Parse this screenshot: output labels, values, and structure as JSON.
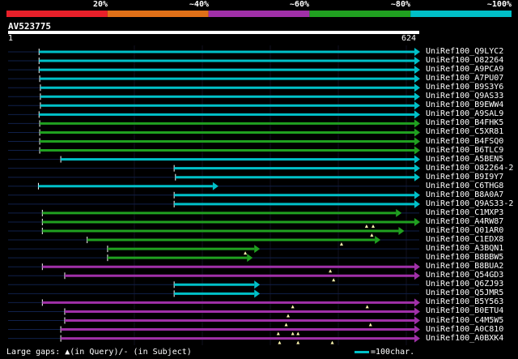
{
  "colors": {
    "red": "#e8202a",
    "orange": "#e07018",
    "purple": "#a030a8",
    "green": "#20a020",
    "cyan": "#00c0c8",
    "gap_marker": "#fff8b0",
    "faint_line": "#10204a",
    "grid": "#101020"
  },
  "legend_bar": {
    "segments": [
      {
        "label": "20%",
        "color": "#e8202a"
      },
      {
        "label": "~40%",
        "color": "#e07018"
      },
      {
        "label": "~60%",
        "color": "#a030a8"
      },
      {
        "label": "~80%",
        "color": "#20a020"
      },
      {
        "label": "~100%",
        "color": "#00c0c8"
      }
    ]
  },
  "query": {
    "name": "AV523775",
    "start": "1",
    "end": "624",
    "length": 624
  },
  "hits": [
    {
      "label": "UniRef100_Q9LYC2",
      "color": "cyan",
      "start": 47,
      "end": 624,
      "gaps": []
    },
    {
      "label": "UniRef100_O82264",
      "color": "cyan",
      "start": 47,
      "end": 624,
      "gaps": []
    },
    {
      "label": "UniRef100_A9PCA9",
      "color": "cyan",
      "start": 47,
      "end": 624,
      "gaps": []
    },
    {
      "label": "UniRef100_A7PU07",
      "color": "cyan",
      "start": 48,
      "end": 624,
      "gaps": []
    },
    {
      "label": "UniRef100_B9S3Y6",
      "color": "cyan",
      "start": 49,
      "end": 624,
      "gaps": []
    },
    {
      "label": "UniRef100_Q9AS33",
      "color": "cyan",
      "start": 49,
      "end": 624,
      "gaps": []
    },
    {
      "label": "UniRef100_B9EWW4",
      "color": "cyan",
      "start": 49,
      "end": 624,
      "gaps": []
    },
    {
      "label": "UniRef100_A9SAL9",
      "color": "cyan",
      "start": 47,
      "end": 624,
      "gaps": []
    },
    {
      "label": "UniRef100_B4FHK5",
      "color": "green",
      "start": 48,
      "end": 624,
      "gaps": []
    },
    {
      "label": "UniRef100_C5XR81",
      "color": "green",
      "start": 48,
      "end": 624,
      "gaps": []
    },
    {
      "label": "UniRef100_B4FSQ0",
      "color": "green",
      "start": 48,
      "end": 624,
      "gaps": []
    },
    {
      "label": "UniRef100_B6TLC9",
      "color": "green",
      "start": 48,
      "end": 624,
      "gaps": []
    },
    {
      "label": "UniRef100_A5BEN5",
      "color": "cyan",
      "start": 80,
      "end": 624,
      "gaps": []
    },
    {
      "label": "UniRef100_O82264-2",
      "color": "cyan",
      "start": 252,
      "end": 624,
      "gaps": []
    },
    {
      "label": "UniRef100_B9I9Y7",
      "color": "cyan",
      "start": 254,
      "end": 624,
      "gaps": []
    },
    {
      "label": "UniRef100_C6THG8",
      "color": "cyan",
      "start": 46,
      "end": 318,
      "gaps": []
    },
    {
      "label": "UniRef100_B8A0A7",
      "color": "cyan",
      "start": 252,
      "end": 624,
      "gaps": []
    },
    {
      "label": "UniRef100_Q9AS33-2",
      "color": "cyan",
      "start": 252,
      "end": 624,
      "gaps": []
    },
    {
      "label": "UniRef100_C1MXP3",
      "color": "green",
      "start": 52,
      "end": 596,
      "gaps": []
    },
    {
      "label": "UniRef100_A4RW87",
      "color": "green",
      "start": 52,
      "end": 624,
      "gaps": [
        544,
        554
      ]
    },
    {
      "label": "UniRef100_Q01AR0",
      "color": "green",
      "start": 52,
      "end": 600,
      "gaps": [
        552
      ]
    },
    {
      "label": "UniRef100_C1EDX8",
      "color": "green",
      "start": 120,
      "end": 564,
      "gaps": [
        506
      ]
    },
    {
      "label": "UniRef100_A3BQN1",
      "color": "green",
      "start": 151,
      "end": 381,
      "gaps": [
        360
      ]
    },
    {
      "label": "UniRef100_B8BBW5",
      "color": "green",
      "start": 151,
      "end": 370,
      "gaps": []
    },
    {
      "label": "UniRef100_B8BUA2",
      "color": "purple",
      "start": 52,
      "end": 624,
      "gaps": [
        489
      ]
    },
    {
      "label": "UniRef100_Q54GD3",
      "color": "purple",
      "start": 86,
      "end": 624,
      "gaps": [
        494
      ]
    },
    {
      "label": "UniRef100_Q6ZJ93",
      "color": "cyan",
      "start": 252,
      "end": 381,
      "gaps": []
    },
    {
      "label": "UniRef100_Q5JMR5",
      "color": "cyan",
      "start": 252,
      "end": 381,
      "gaps": []
    },
    {
      "label": "UniRef100_B5Y563",
      "color": "purple",
      "start": 52,
      "end": 624,
      "gaps": [
        432,
        545
      ]
    },
    {
      "label": "UniRef100_B0ETU4",
      "color": "purple",
      "start": 86,
      "end": 624,
      "gaps": [
        425
      ]
    },
    {
      "label": "UniRef100_C4M5W5",
      "color": "purple",
      "start": 86,
      "end": 624,
      "gaps": [
        422,
        550
      ]
    },
    {
      "label": "UniRef100_A0C810",
      "color": "purple",
      "start": 80,
      "end": 624,
      "gaps": [
        410,
        432,
        440
      ]
    },
    {
      "label": "UniRef100_A0BXK4",
      "color": "purple",
      "start": 80,
      "end": 624,
      "gaps": [
        412,
        440,
        492
      ]
    }
  ],
  "footer": {
    "legend_text": "Large gaps: ▲(in Query)/- (in Subject)",
    "scale_text": "=100char."
  }
}
